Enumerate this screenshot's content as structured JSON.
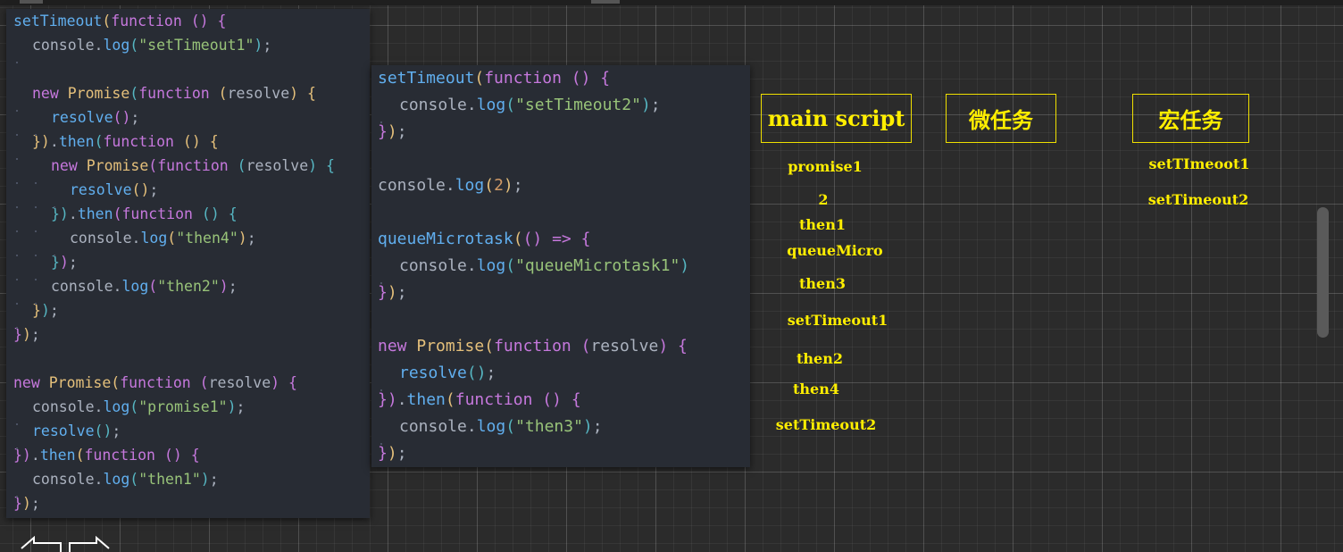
{
  "code_left": [
    [
      [
        "fn",
        "setTimeout"
      ],
      [
        "p1",
        "("
      ],
      [
        "kw",
        "function"
      ],
      [
        "plain",
        " "
      ],
      [
        "p2",
        "()"
      ],
      [
        "plain",
        " "
      ],
      [
        "p2",
        "{"
      ]
    ],
    [
      "I",
      [
        "plain",
        "console."
      ],
      [
        "fn",
        "log"
      ],
      [
        "p3",
        "("
      ],
      [
        "str",
        "\"setTimeout1\""
      ],
      [
        "p3",
        ")"
      ],
      [
        "plain",
        ";"
      ]
    ],
    [],
    [
      "I",
      [
        "kw",
        "new"
      ],
      [
        "plain",
        " "
      ],
      [
        "cls",
        "Promise"
      ],
      [
        "p3",
        "("
      ],
      [
        "kw",
        "function"
      ],
      [
        "plain",
        " "
      ],
      [
        "p1",
        "("
      ],
      [
        "param",
        "resolve"
      ],
      [
        "p1",
        ")"
      ],
      [
        "plain",
        " "
      ],
      [
        "p1",
        "{"
      ]
    ],
    [
      "I",
      "I",
      [
        "fn",
        "resolve"
      ],
      [
        "p2",
        "()"
      ],
      [
        "plain",
        ";"
      ]
    ],
    [
      "I",
      [
        "p1",
        "})"
      ],
      [
        "plain",
        "."
      ],
      [
        "fn",
        "then"
      ],
      [
        "p3",
        "("
      ],
      [
        "kw",
        "function"
      ],
      [
        "plain",
        " "
      ],
      [
        "p1",
        "()"
      ],
      [
        "plain",
        " "
      ],
      [
        "p1",
        "{"
      ]
    ],
    [
      "I",
      "I",
      [
        "kw",
        "new"
      ],
      [
        "plain",
        " "
      ],
      [
        "cls",
        "Promise"
      ],
      [
        "p2",
        "("
      ],
      [
        "kw",
        "function"
      ],
      [
        "plain",
        " "
      ],
      [
        "p3",
        "("
      ],
      [
        "param",
        "resolve"
      ],
      [
        "p3",
        ")"
      ],
      [
        "plain",
        " "
      ],
      [
        "p3",
        "{"
      ]
    ],
    [
      "I",
      "I",
      "I",
      [
        "fn",
        "resolve"
      ],
      [
        "p1",
        "()"
      ],
      [
        "plain",
        ";"
      ]
    ],
    [
      "I",
      "I",
      [
        "p3",
        "})"
      ],
      [
        "plain",
        "."
      ],
      [
        "fn",
        "then"
      ],
      [
        "p2",
        "("
      ],
      [
        "kw",
        "function"
      ],
      [
        "plain",
        " "
      ],
      [
        "p3",
        "()"
      ],
      [
        "plain",
        " "
      ],
      [
        "p3",
        "{"
      ]
    ],
    [
      "I",
      "I",
      "I",
      [
        "plain",
        "console."
      ],
      [
        "fn",
        "log"
      ],
      [
        "p1",
        "("
      ],
      [
        "str",
        "\"then4\""
      ],
      [
        "p1",
        ")"
      ],
      [
        "plain",
        ";"
      ]
    ],
    [
      "I",
      "I",
      [
        "p3",
        "}"
      ],
      [
        "p2",
        ")"
      ],
      [
        "plain",
        ";"
      ]
    ],
    [
      "I",
      "I",
      [
        "plain",
        "console."
      ],
      [
        "fn",
        "log"
      ],
      [
        "p2",
        "("
      ],
      [
        "str",
        "\"then2\""
      ],
      [
        "p2",
        ")"
      ],
      [
        "plain",
        ";"
      ]
    ],
    [
      "I",
      [
        "p1",
        "}"
      ],
      [
        "p3",
        ")"
      ],
      [
        "plain",
        ";"
      ]
    ],
    [
      [
        "p2",
        "}"
      ],
      [
        "p1",
        ")"
      ],
      [
        "plain",
        ";"
      ]
    ],
    [],
    [
      [
        "kw",
        "new"
      ],
      [
        "plain",
        " "
      ],
      [
        "cls",
        "Promise"
      ],
      [
        "p1",
        "("
      ],
      [
        "kw",
        "function"
      ],
      [
        "plain",
        " "
      ],
      [
        "p2",
        "("
      ],
      [
        "param",
        "resolve"
      ],
      [
        "p2",
        ")"
      ],
      [
        "plain",
        " "
      ],
      [
        "p2",
        "{"
      ]
    ],
    [
      "I",
      [
        "plain",
        "console."
      ],
      [
        "fn",
        "log"
      ],
      [
        "p3",
        "("
      ],
      [
        "str",
        "\"promise1\""
      ],
      [
        "p3",
        ")"
      ],
      [
        "plain",
        ";"
      ]
    ],
    [
      "I",
      [
        "fn",
        "resolve"
      ],
      [
        "p3",
        "()"
      ],
      [
        "plain",
        ";"
      ]
    ],
    [
      [
        "p2",
        "})"
      ],
      [
        "plain",
        "."
      ],
      [
        "fn",
        "then"
      ],
      [
        "p1",
        "("
      ],
      [
        "kw",
        "function"
      ],
      [
        "plain",
        " "
      ],
      [
        "p2",
        "()"
      ],
      [
        "plain",
        " "
      ],
      [
        "p2",
        "{"
      ]
    ],
    [
      "I",
      [
        "plain",
        "console."
      ],
      [
        "fn",
        "log"
      ],
      [
        "p3",
        "("
      ],
      [
        "str",
        "\"then1\""
      ],
      [
        "p3",
        ")"
      ],
      [
        "plain",
        ";"
      ]
    ],
    [
      [
        "p2",
        "}"
      ],
      [
        "p1",
        ")"
      ],
      [
        "plain",
        ";"
      ]
    ]
  ],
  "code_mid": [
    [
      [
        "fn",
        "setTimeout"
      ],
      [
        "p1",
        "("
      ],
      [
        "kw",
        "function"
      ],
      [
        "plain",
        " "
      ],
      [
        "p2",
        "()"
      ],
      [
        "plain",
        " "
      ],
      [
        "p2",
        "{"
      ]
    ],
    [
      "I",
      [
        "plain",
        "console."
      ],
      [
        "fn",
        "log"
      ],
      [
        "p3",
        "("
      ],
      [
        "str",
        "\"setTimeout2\""
      ],
      [
        "p3",
        ")"
      ],
      [
        "plain",
        ";"
      ]
    ],
    [
      [
        "p2",
        "}"
      ],
      [
        "p1",
        ")"
      ],
      [
        "plain",
        ";"
      ]
    ],
    [],
    [
      [
        "plain",
        "console."
      ],
      [
        "fn",
        "log"
      ],
      [
        "p1",
        "("
      ],
      [
        "num",
        "2"
      ],
      [
        "p1",
        ")"
      ],
      [
        "plain",
        ";"
      ]
    ],
    [],
    [
      [
        "fn",
        "queueMicrotask"
      ],
      [
        "p1",
        "("
      ],
      [
        "p2",
        "()"
      ],
      [
        "plain",
        " "
      ],
      [
        "kw",
        "=>"
      ],
      [
        "plain",
        " "
      ],
      [
        "p2",
        "{"
      ]
    ],
    [
      "I",
      [
        "plain",
        "console."
      ],
      [
        "fn",
        "log"
      ],
      [
        "p3",
        "("
      ],
      [
        "str",
        "\"queueMicrotask1\""
      ],
      [
        "p3",
        ")"
      ]
    ],
    [
      [
        "p2",
        "}"
      ],
      [
        "p1",
        ")"
      ],
      [
        "plain",
        ";"
      ]
    ],
    [],
    [
      [
        "kw",
        "new"
      ],
      [
        "plain",
        " "
      ],
      [
        "cls",
        "Promise"
      ],
      [
        "p1",
        "("
      ],
      [
        "kw",
        "function"
      ],
      [
        "plain",
        " "
      ],
      [
        "p2",
        "("
      ],
      [
        "param",
        "resolve"
      ],
      [
        "p2",
        ")"
      ],
      [
        "plain",
        " "
      ],
      [
        "p2",
        "{"
      ]
    ],
    [
      "I",
      [
        "fn",
        "resolve"
      ],
      [
        "p3",
        "()"
      ],
      [
        "plain",
        ";"
      ]
    ],
    [
      [
        "p2",
        "})"
      ],
      [
        "plain",
        "."
      ],
      [
        "fn",
        "then"
      ],
      [
        "p1",
        "("
      ],
      [
        "kw",
        "function"
      ],
      [
        "plain",
        " "
      ],
      [
        "p2",
        "()"
      ],
      [
        "plain",
        " "
      ],
      [
        "p2",
        "{"
      ]
    ],
    [
      "I",
      [
        "plain",
        "console."
      ],
      [
        "fn",
        "log"
      ],
      [
        "p3",
        "("
      ],
      [
        "str",
        "\"then3\""
      ],
      [
        "p3",
        ")"
      ],
      [
        "plain",
        ";"
      ]
    ],
    [
      [
        "p2",
        "}"
      ],
      [
        "p1",
        ")"
      ],
      [
        "plain",
        ";"
      ]
    ]
  ],
  "boxes": {
    "main_script": "main script",
    "microtask": "微任务",
    "macrotask": "宏任务"
  },
  "main_script_outputs": [
    "promise1",
    "2",
    "then1",
    "queueMicro",
    "then3",
    "setTimeout1",
    "then2",
    "then4",
    "setTimeout2"
  ],
  "macrotask_items": [
    "setTImeoot1",
    "setTimeout2"
  ],
  "colors": {
    "annotation": "#ffee00",
    "editor_bg": "#282c34",
    "canvas_bg": "#2b2b2b"
  }
}
